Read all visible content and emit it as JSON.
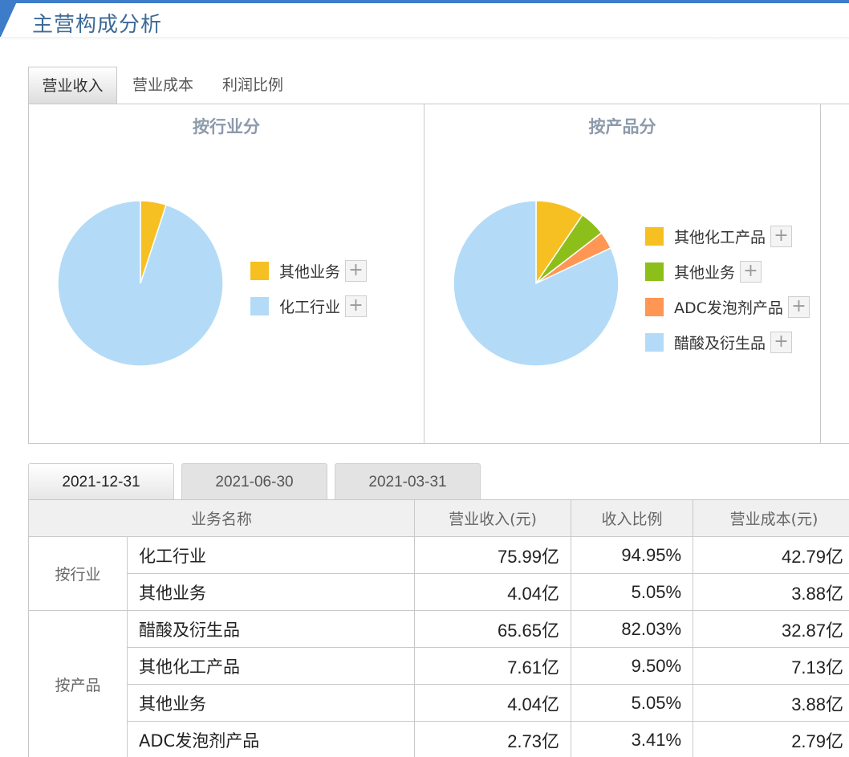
{
  "header": {
    "title": "主营构成分析"
  },
  "top_tabs": [
    {
      "label": "营业收入",
      "active": true
    },
    {
      "label": "营业成本",
      "active": false
    },
    {
      "label": "利润比例",
      "active": false
    }
  ],
  "chart_data": [
    {
      "type": "pie",
      "title": "按行业分",
      "series": [
        {
          "name": "其他业务",
          "value": 5.05,
          "color": "#f6c022"
        },
        {
          "name": "化工行业",
          "value": 94.95,
          "color": "#b3dbf7"
        }
      ],
      "legend_position": "right"
    },
    {
      "type": "pie",
      "title": "按产品分",
      "series": [
        {
          "name": "其他化工产品",
          "value": 9.5,
          "color": "#f6c022"
        },
        {
          "name": "其他业务",
          "value": 5.05,
          "color": "#8cbf1a"
        },
        {
          "name": "ADC发泡剂产品",
          "value": 3.41,
          "color": "#ff9654"
        },
        {
          "name": "醋酸及衍生品",
          "value": 82.03,
          "color": "#b3dbf7"
        }
      ],
      "legend_position": "right"
    }
  ],
  "legend_expand_symbol": "+",
  "date_tabs": [
    {
      "label": "2021-12-31",
      "active": true
    },
    {
      "label": "2021-06-30",
      "active": false
    },
    {
      "label": "2021-03-31",
      "active": false
    }
  ],
  "table": {
    "headers": {
      "name": "业务名称",
      "revenue": "营业收入(元)",
      "ratio": "收入比例",
      "cost": "营业成本(元)"
    },
    "groups": [
      {
        "label": "按行业",
        "rows": [
          {
            "name": "化工行业",
            "revenue": "75.99亿",
            "ratio": "94.95%",
            "cost": "42.79亿"
          },
          {
            "name": "其他业务",
            "revenue": "4.04亿",
            "ratio": "5.05%",
            "cost": "3.88亿"
          }
        ]
      },
      {
        "label": "按产品",
        "rows": [
          {
            "name": "醋酸及衍生品",
            "revenue": "65.65亿",
            "ratio": "82.03%",
            "cost": "32.87亿"
          },
          {
            "name": "其他化工产品",
            "revenue": "7.61亿",
            "ratio": "9.50%",
            "cost": "7.13亿"
          },
          {
            "name": "其他业务",
            "revenue": "4.04亿",
            "ratio": "5.05%",
            "cost": "3.88亿"
          },
          {
            "name": "ADC发泡剂产品",
            "revenue": "2.73亿",
            "ratio": "3.41%",
            "cost": "2.79亿"
          }
        ]
      }
    ]
  }
}
